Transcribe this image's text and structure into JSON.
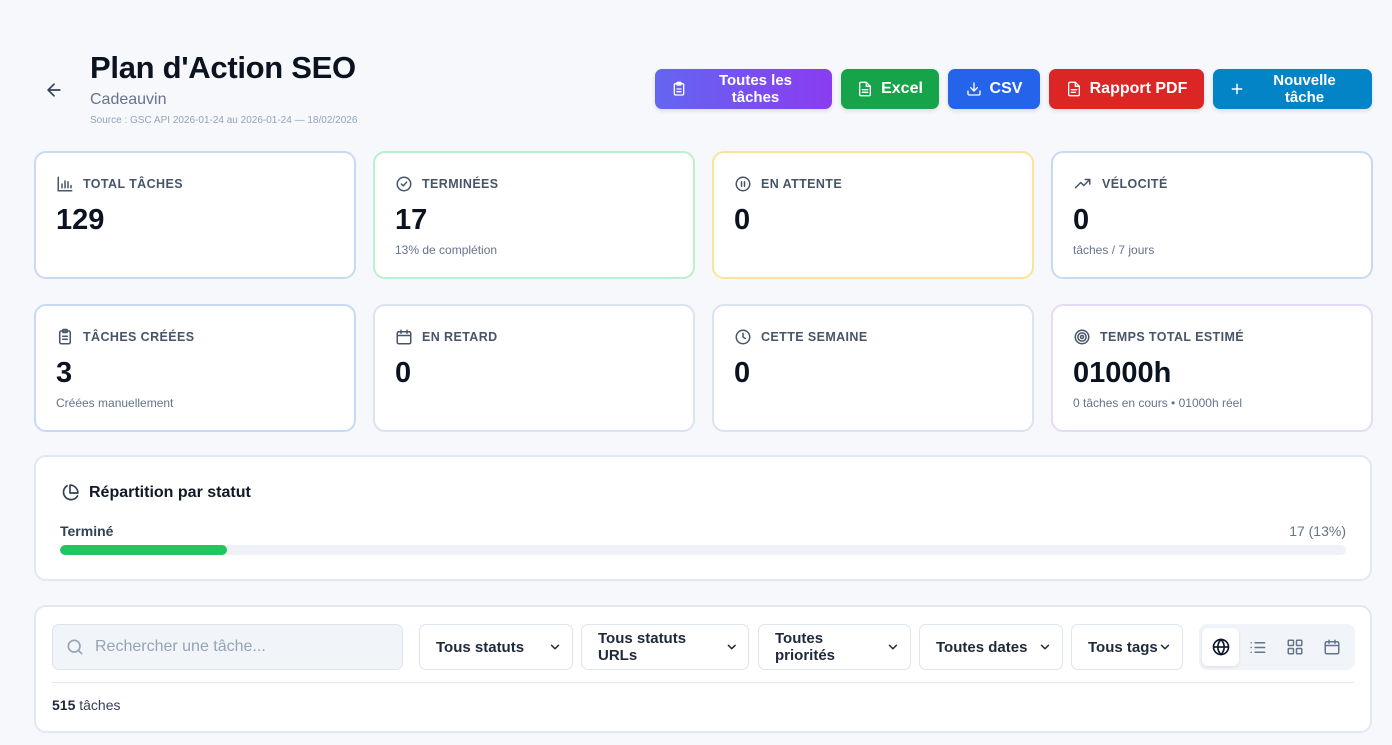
{
  "header": {
    "title": "Plan d'Action SEO",
    "subtitle": "Cadeauvin",
    "source": "Source : GSC API 2026-01-24 au 2026-01-24 — 18/02/2026"
  },
  "actions": {
    "all_tasks": "Toutes les tâches",
    "excel": "Excel",
    "csv": "CSV",
    "pdf": "Rapport PDF",
    "new_task": "Nouvelle tâche"
  },
  "stats": [
    {
      "label": "TOTAL TÂCHES",
      "value": "129",
      "sub": "",
      "icon": "bar-chart-icon"
    },
    {
      "label": "TERMINÉES",
      "value": "17",
      "sub": "13% de complétion",
      "icon": "check-circle-icon"
    },
    {
      "label": "EN ATTENTE",
      "value": "0",
      "sub": "",
      "icon": "pause-circle-icon"
    },
    {
      "label": "VÉLOCITÉ",
      "value": "0",
      "sub": "tâches / 7 jours",
      "icon": "trending-up-icon"
    },
    {
      "label": "TÂCHES CRÉÉES",
      "value": "3",
      "sub": "Créées manuellement",
      "icon": "clipboard-icon"
    },
    {
      "label": "EN RETARD",
      "value": "0",
      "sub": "",
      "icon": "calendar-icon"
    },
    {
      "label": "CETTE SEMAINE",
      "value": "0",
      "sub": "",
      "icon": "clock-icon"
    },
    {
      "label": "TEMPS TOTAL ESTIMÉ",
      "value": "01000h",
      "sub": "0 tâches en cours • 01000h réel",
      "icon": "target-icon"
    }
  ],
  "status": {
    "title": "Répartition par statut",
    "rows": [
      {
        "label": "Terminé",
        "value": "17 (13%)",
        "fraction": 0.13,
        "color": "#22c55e"
      }
    ]
  },
  "filters": {
    "search_placeholder": "Rechercher une tâche...",
    "status": "Tous statuts",
    "url_status": "Tous statuts URLs",
    "priority": "Toutes priorités",
    "dates": "Toutes dates",
    "tags": "Tous tags",
    "views": [
      "globe-icon",
      "list-icon",
      "grid-icon",
      "calendar-icon"
    ],
    "active_view": "globe-icon",
    "count": "515",
    "count_suffix": " tâches"
  },
  "colors": {
    "all_tasks": "#7c3aed",
    "excel": "#16a34a",
    "csv": "#2563eb",
    "pdf": "#dc2626",
    "new_task": "#0284c7",
    "progress": "#22c55e"
  }
}
